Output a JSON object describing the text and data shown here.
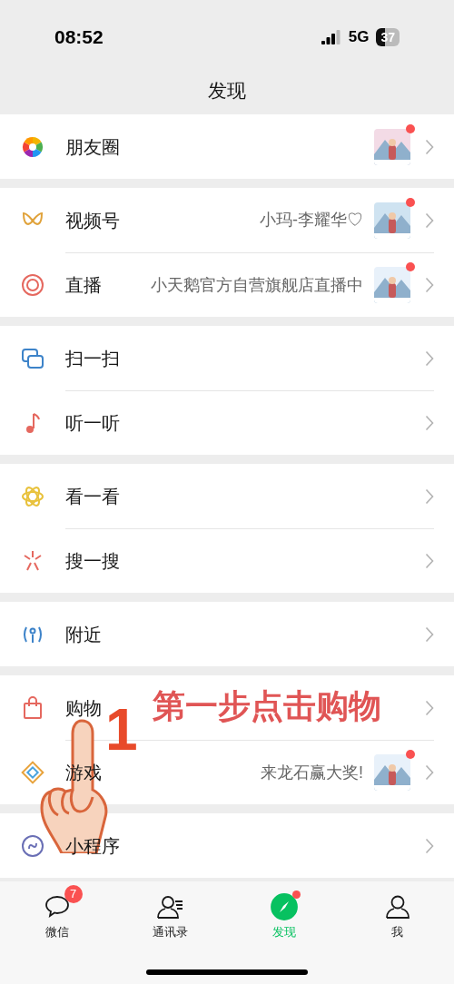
{
  "status_bar": {
    "time": "08:52",
    "network": "5G",
    "battery": "37"
  },
  "header": {
    "title": "发现"
  },
  "groups": [
    {
      "items": [
        {
          "kind": "moments",
          "label": "朋友圈",
          "thumbnail": true,
          "dot": true
        }
      ]
    },
    {
      "items": [
        {
          "kind": "channels",
          "label": "视频号",
          "thumbnail": true,
          "dot": true,
          "detail": "小玛-李耀华♡"
        },
        {
          "kind": "live",
          "label": "直播",
          "detail": "小天鹅官方自营旗舰店直播中",
          "thumbnail": true,
          "dot": true
        }
      ]
    },
    {
      "items": [
        {
          "kind": "scan",
          "label": "扫一扫"
        },
        {
          "kind": "shake",
          "label": "听一听"
        }
      ]
    },
    {
      "items": [
        {
          "kind": "top",
          "label": "看一看"
        },
        {
          "kind": "search",
          "label": "搜一搜"
        }
      ]
    },
    {
      "items": [
        {
          "kind": "nearby",
          "label": "附近"
        }
      ]
    },
    {
      "items": [
        {
          "kind": "shop",
          "label": "购物"
        },
        {
          "kind": "game",
          "label": "游戏",
          "detail": "来龙石赢大奖!",
          "thumbnail": true,
          "dot": true
        }
      ]
    },
    {
      "items": [
        {
          "kind": "mini",
          "label": "小程序"
        }
      ]
    }
  ],
  "annotation": {
    "step": "1",
    "text": "第一步点击购物"
  },
  "tabs": [
    {
      "kind": "chat",
      "label": "微信",
      "selected": false,
      "badge": "7",
      "dot": false
    },
    {
      "kind": "contacts",
      "label": "通讯录",
      "selected": false,
      "dot": false
    },
    {
      "kind": "discover",
      "label": "发现",
      "selected": true,
      "dot": true
    },
    {
      "kind": "me",
      "label": "我",
      "selected": false,
      "dot": false
    }
  ]
}
